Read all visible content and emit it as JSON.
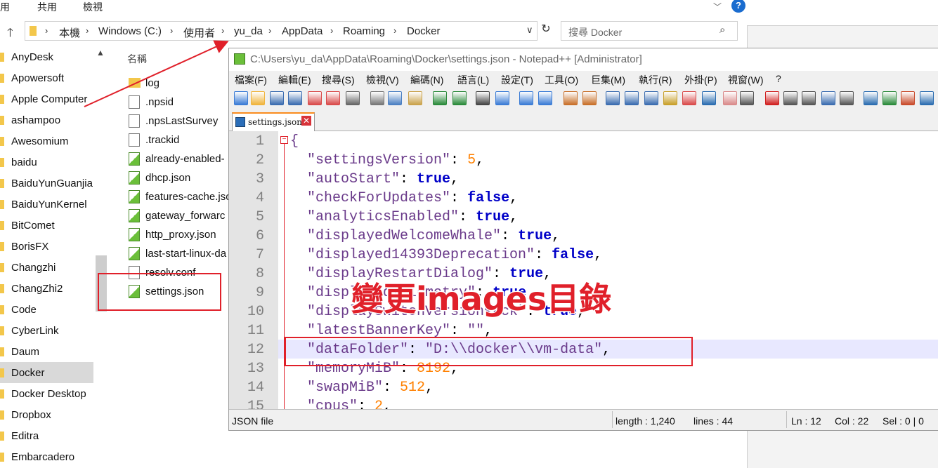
{
  "explorer": {
    "ribbon": {
      "tab_view_partial": "使用",
      "tab_share": "共用",
      "tab_view": "檢視"
    },
    "address": {
      "crumbs": [
        "本機",
        "Windows (C:)",
        "使用者",
        "yu_da",
        "AppData",
        "Roaming",
        "Docker"
      ],
      "separator": "›"
    },
    "search": {
      "placeholder": "搜尋 Docker"
    },
    "nav_items": [
      "AnyDesk",
      "Apowersoft",
      "Apple Computer",
      "ashampoo",
      "Awesomium",
      "baidu",
      "BaiduYunGuanjia",
      "BaiduYunKernel",
      "BitComet",
      "BorisFX",
      "Changzhi",
      "ChangZhi2",
      "Code",
      "CyberLink",
      "Daum",
      "Docker",
      "Docker Desktop",
      "Dropbox",
      "Editra",
      "Embarcadero"
    ],
    "selected_nav": "Docker",
    "column_header": "名稱",
    "files": [
      {
        "name": "log",
        "type": "folder"
      },
      {
        "name": ".npsid",
        "type": "doc"
      },
      {
        "name": ".npsLastSurvey",
        "type": "doc"
      },
      {
        "name": ".trackid",
        "type": "doc"
      },
      {
        "name": "already-enabled-",
        "type": "npp"
      },
      {
        "name": "dhcp.json",
        "type": "npp"
      },
      {
        "name": "features-cache.jso",
        "type": "npp"
      },
      {
        "name": "gateway_forwarc",
        "type": "npp"
      },
      {
        "name": "http_proxy.json",
        "type": "npp"
      },
      {
        "name": "last-start-linux-da",
        "type": "npp"
      },
      {
        "name": "resolv.conf",
        "type": "doc"
      },
      {
        "name": "settings.json",
        "type": "npp"
      }
    ]
  },
  "npp": {
    "title": "C:\\Users\\yu_da\\AppData\\Roaming\\Docker\\settings.json - Notepad++ [Administrator]",
    "menu": [
      "檔案(F)",
      "編輯(E)",
      "搜尋(S)",
      "檢視(V)",
      "編碼(N)",
      "語言(L)",
      "設定(T)",
      "工具(O)",
      "巨集(M)",
      "執行(R)",
      "外掛(P)",
      "視窗(W)",
      "?"
    ],
    "tab_label": "settings.json",
    "tab_close": "✕",
    "lines": [
      {
        "n": "1",
        "parts": [
          [
            "brace",
            "{"
          ]
        ]
      },
      {
        "n": "2",
        "parts": [
          [
            "k",
            "  \"settingsVersion\""
          ],
          [
            "p",
            ": "
          ],
          [
            "num",
            "5"
          ],
          [
            "p",
            ","
          ]
        ]
      },
      {
        "n": "3",
        "parts": [
          [
            "k",
            "  \"autoStart\""
          ],
          [
            "p",
            ": "
          ],
          [
            "kw",
            "true"
          ],
          [
            "p",
            ","
          ]
        ]
      },
      {
        "n": "4",
        "parts": [
          [
            "k",
            "  \"checkForUpdates\""
          ],
          [
            "p",
            ": "
          ],
          [
            "kw",
            "false"
          ],
          [
            "p",
            ","
          ]
        ]
      },
      {
        "n": "5",
        "parts": [
          [
            "k",
            "  \"analyticsEnabled\""
          ],
          [
            "p",
            ": "
          ],
          [
            "kw",
            "true"
          ],
          [
            "p",
            ","
          ]
        ]
      },
      {
        "n": "6",
        "parts": [
          [
            "k",
            "  \"displayedWelcomeWhale\""
          ],
          [
            "p",
            ": "
          ],
          [
            "kw",
            "true"
          ],
          [
            "p",
            ","
          ]
        ]
      },
      {
        "n": "7",
        "parts": [
          [
            "k",
            "  \"displayed14393Deprecation\""
          ],
          [
            "p",
            ": "
          ],
          [
            "kw",
            "false"
          ],
          [
            "p",
            ","
          ]
        ]
      },
      {
        "n": "8",
        "parts": [
          [
            "k",
            "  \"displayRestartDialog\""
          ],
          [
            "p",
            ": "
          ],
          [
            "kw",
            "true"
          ],
          [
            "p",
            ","
          ]
        ]
      },
      {
        "n": "9",
        "parts": [
          [
            "k",
            "  \"displayedTelemetry\""
          ],
          [
            "p",
            ": "
          ],
          [
            "kw",
            "true"
          ],
          [
            "p",
            ","
          ]
        ]
      },
      {
        "n": "10",
        "parts": [
          [
            "k",
            "  \"displaySwitchVersionPack\""
          ],
          [
            "p",
            ": "
          ],
          [
            "kw",
            "true"
          ],
          [
            "p",
            ","
          ]
        ]
      },
      {
        "n": "11",
        "parts": [
          [
            "k",
            "  \"latestBannerKey\""
          ],
          [
            "p",
            ": "
          ],
          [
            "s",
            "\"\""
          ],
          [
            "p",
            ","
          ]
        ]
      },
      {
        "n": "12",
        "parts": [
          [
            "k",
            "  \"dataFolder\""
          ],
          [
            "p",
            ": "
          ],
          [
            "s",
            "\"D:\\\\docker\\\\vm-data\""
          ],
          [
            "p",
            ","
          ]
        ]
      },
      {
        "n": "13",
        "parts": [
          [
            "k",
            "  \"memoryMiB\""
          ],
          [
            "p",
            ": "
          ],
          [
            "num",
            "8192"
          ],
          [
            "p",
            ","
          ]
        ]
      },
      {
        "n": "14",
        "parts": [
          [
            "k",
            "  \"swapMiB\""
          ],
          [
            "p",
            ": "
          ],
          [
            "num",
            "512"
          ],
          [
            "p",
            ","
          ]
        ]
      },
      {
        "n": "15",
        "parts": [
          [
            "k",
            "  \"cpus\""
          ],
          [
            "p",
            ": "
          ],
          [
            "num",
            "2"
          ],
          [
            "p",
            ","
          ]
        ]
      }
    ],
    "annotation": "變更images目錄",
    "status": {
      "file_type": "JSON file",
      "length": "length : 1,240",
      "lines": "lines : 44",
      "ln": "Ln : 12",
      "col": "Col : 22",
      "sel": "Sel : 0 | 0"
    }
  },
  "colors": {
    "annotation_red": "#e0202a",
    "npp_tab_accent": "#fa8c1e",
    "keyword_blue": "#0000c8",
    "number_orange": "#ff8000"
  }
}
